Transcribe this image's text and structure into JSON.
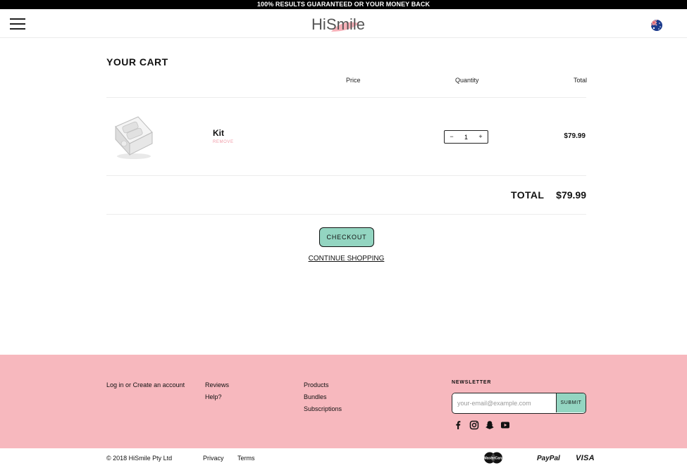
{
  "announcement": "100% RESULTS GUARANTEED OR YOUR MONEY BACK",
  "header": {
    "logo_text": "HiSmile",
    "logo_left": "Hi",
    "logo_right": "Smile",
    "menu_icon": "hamburger-icon",
    "region_icon": "australia-flag-icon"
  },
  "cart": {
    "title": "YOUR CART",
    "columns": {
      "price": "Price",
      "quantity": "Quantity",
      "total": "Total"
    },
    "items": [
      {
        "name": "Kit",
        "remove_label": "REMOVE",
        "quantity": "1",
        "decrement": "−",
        "increment": "+",
        "line_total": "$79.99"
      }
    ],
    "total_label": "TOTAL",
    "total_value": "$79.99",
    "checkout_label": "CHECKOUT",
    "continue_label": "CONTINUE SHOPPING"
  },
  "footer": {
    "account": {
      "login": "Log in",
      "or": "or",
      "create": "Create an account"
    },
    "col2": [
      "Reviews",
      "Help?"
    ],
    "col3": [
      "Products",
      "Bundles",
      "Subscriptions"
    ],
    "newsletter": {
      "label": "NEWSLETTER",
      "placeholder": "your-email@example.com",
      "submit": "SUBMIT"
    },
    "social_icons": [
      "facebook-icon",
      "instagram-icon",
      "snapchat-icon",
      "youtube-icon"
    ],
    "copyright": "© 2018 HiSmile Pty Ltd",
    "privacy": "Privacy",
    "terms": "Terms",
    "payments": {
      "mastercard": "MasterCard",
      "paypal": "PayPal",
      "visa": "VISA"
    }
  },
  "colors": {
    "accent_mint": "#93d5c1",
    "footer_pink": "#f7b8be",
    "remove_pink": "#f09aa6",
    "logo_pink": "#f7a3ad",
    "logo_grey": "#555555"
  }
}
